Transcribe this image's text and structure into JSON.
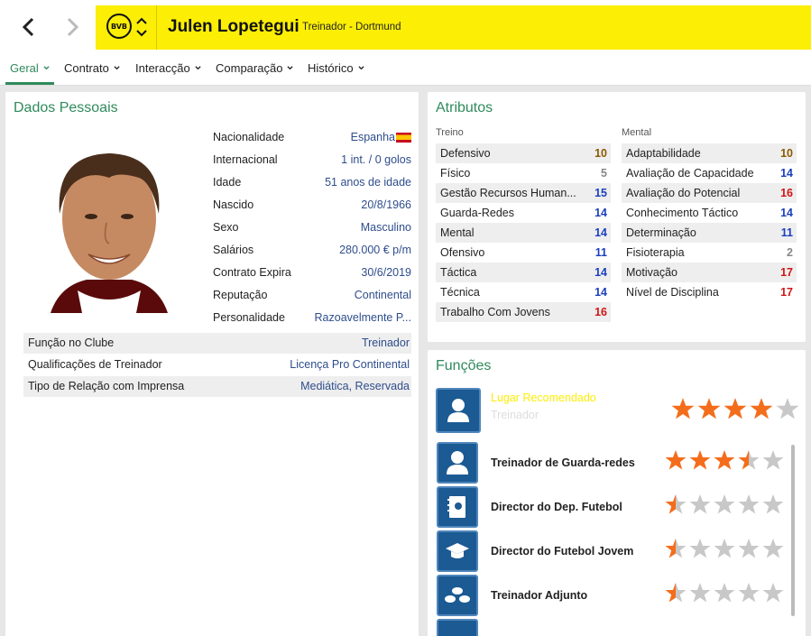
{
  "header": {
    "title": "Julen Lopetegui",
    "subtitle": "Treinador - Dortmund",
    "club_badge_text": "BVB",
    "accent_color": "#fcee05"
  },
  "tabs": [
    {
      "label": "Geral",
      "active": true
    },
    {
      "label": "Contrato",
      "active": false
    },
    {
      "label": "Interacção",
      "active": false
    },
    {
      "label": "Comparação",
      "active": false
    },
    {
      "label": "Histórico",
      "active": false
    }
  ],
  "personal": {
    "title": "Dados Pessoais",
    "rows": [
      {
        "label": "Nacionalidade",
        "value": "Espanha"
      },
      {
        "label": "Internacional",
        "value": "1 int. / 0 golos"
      },
      {
        "label": "Idade",
        "value": "51 anos de idade"
      },
      {
        "label": "Nascido",
        "value": "20/8/1966"
      },
      {
        "label": "Sexo",
        "value": "Masculino"
      },
      {
        "label": "Salários",
        "value": "280.000 € p/m"
      },
      {
        "label": "Contrato Expira",
        "value": "30/6/2019"
      },
      {
        "label": "Reputação",
        "value": "Continental"
      },
      {
        "label": "Personalidade",
        "value": "Razoavelmente P..."
      }
    ],
    "club_rows": [
      {
        "label": "Função no Clube",
        "value": "Treinador"
      },
      {
        "label": "Qualificações de Treinador",
        "value": "Licença Pro Continental"
      },
      {
        "label": "Tipo de Relação com Imprensa",
        "value": "Mediática, Reservada"
      }
    ]
  },
  "attributes": {
    "title": "Atributos",
    "treino_label": "Treino",
    "mental_label": "Mental",
    "treino": [
      {
        "label": "Defensivo",
        "value": "10"
      },
      {
        "label": "Físico",
        "value": "5"
      },
      {
        "label": "Gestão Recursos Human...",
        "value": "15"
      },
      {
        "label": "Guarda-Redes",
        "value": "14"
      },
      {
        "label": "Mental",
        "value": "14"
      },
      {
        "label": "Ofensivo",
        "value": "11"
      },
      {
        "label": "Táctica",
        "value": "14"
      },
      {
        "label": "Técnica",
        "value": "14"
      },
      {
        "label": "Trabalho Com Jovens",
        "value": "16"
      }
    ],
    "mental": [
      {
        "label": "Adaptabilidade",
        "value": "10"
      },
      {
        "label": "Avaliação de Capacidade",
        "value": "14"
      },
      {
        "label": "Avaliação do Potencial",
        "value": "16"
      },
      {
        "label": "Conhecimento Táctico",
        "value": "14"
      },
      {
        "label": "Determinação",
        "value": "11"
      },
      {
        "label": "Fisioterapia",
        "value": "2"
      },
      {
        "label": "Motivação",
        "value": "17"
      },
      {
        "label": "Nível de Disciplina",
        "value": "17"
      }
    ],
    "colors": {
      "low": "#888888",
      "mid": "#8a5a00",
      "good": "#1a3fbf",
      "high": "#d01515"
    }
  },
  "roles": {
    "title": "Funções",
    "recommended_label": "Lugar Recomendado",
    "recommended_role": "Treinador",
    "recommended_stars": 4,
    "list": [
      {
        "name": "Treinador de Guarda-redes",
        "stars": 3.5,
        "icon": "person-icon"
      },
      {
        "name": "Director do Dep. Futebol",
        "stars": 0.5,
        "icon": "notebook-icon"
      },
      {
        "name": "Director do Futebol Jovem",
        "stars": 0.5,
        "icon": "graduation-cap-icon"
      },
      {
        "name": "Treinador Adjunto",
        "stars": 0.5,
        "icon": "group-icon"
      }
    ],
    "star_color": "#f46d1b",
    "empty_star_color": "#c8c8c8"
  }
}
